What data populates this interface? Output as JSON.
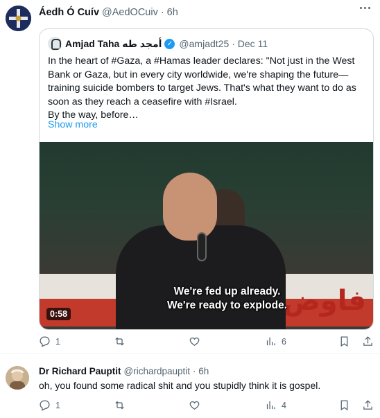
{
  "tweet1": {
    "author_name": "Áedh Ó Cuív",
    "author_handle": "@AedOCuiv",
    "time": "· 6h",
    "more_icon": "more-horizontal-icon",
    "quote": {
      "author_name": "Amjad Taha أمجد طه",
      "author_handle": "@amjadt25",
      "time": "· Dec 11",
      "text": "In the heart of #Gaza, a #Hamas leader declares: \"Not just in the West\nBank or Gaza, but in every city worldwide, we're shaping the future—\ntraining suicide bombers to target Jews. That's what they want to do as\nsoon as they reach a ceasefire with #Israel.\nBy the way, before…",
      "show_more": "Show more",
      "video": {
        "subtitle_line1": "We're fed up already.",
        "subtitle_line2": "We're ready to explode.",
        "duration": "0:58",
        "banner_text": "فاوض ات"
      }
    },
    "actions": {
      "reply_count": "1",
      "retweet_count": "",
      "like_count": "",
      "views_count": "6"
    }
  },
  "tweet2": {
    "author_name": "Dr Richard Pauptit",
    "author_handle": "@richardpauptit",
    "time": "· 6h",
    "text": "oh, you found some radical shit and you stupidly think it is gospel.",
    "actions": {
      "reply_count": "1",
      "retweet_count": "",
      "like_count": "",
      "views_count": "4"
    }
  },
  "colors": {
    "text": "#0f1419",
    "secondary": "#536471",
    "link": "#1d9bf0",
    "border": "#cfd9de"
  }
}
